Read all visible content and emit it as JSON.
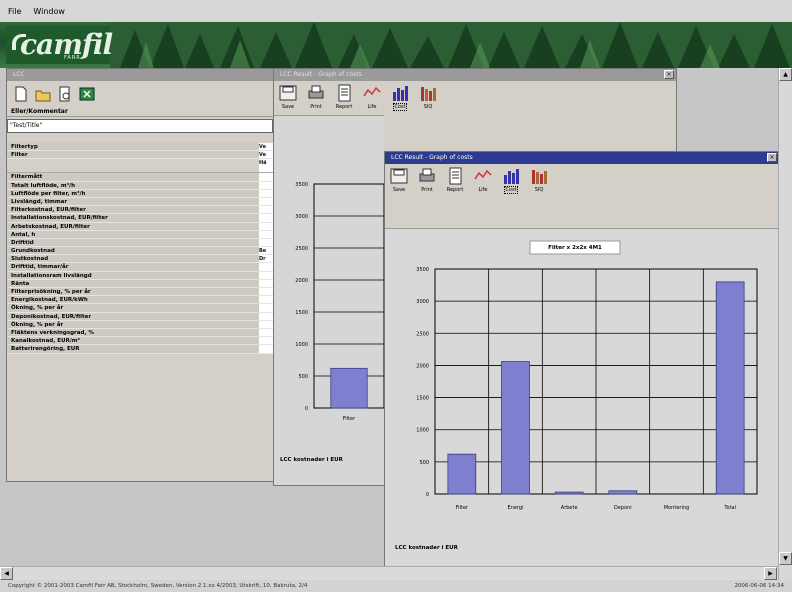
{
  "menubar": {
    "items": [
      "File",
      "Window"
    ]
  },
  "banner": {
    "logo": "camfil",
    "logo_sub": "FARR"
  },
  "input_panel": {
    "title": "LCC",
    "caption": "Eller/Kommentar",
    "text_value": "\"Test/Title\"",
    "params": [
      {
        "label": "Filtertyp",
        "value": "Ve"
      },
      {
        "label": "Filter",
        "value": "Ve"
      },
      {
        "label": "",
        "value": "Hä"
      },
      {
        "label": "Filtermått",
        "value": ""
      },
      {
        "label": "Totalt luftflöde, m³/h",
        "value": ""
      },
      {
        "label": "Luftflöde per filter, m³/h",
        "value": ""
      },
      {
        "label": "Livslängd, timmar",
        "value": ""
      },
      {
        "label": "Filterkostnad, EUR/filter",
        "value": ""
      },
      {
        "label": "Installationskostnad, EUR/filter",
        "value": ""
      },
      {
        "label": "Arbetskostnad, EUR/filter",
        "value": ""
      },
      {
        "label": "Antal, h",
        "value": ""
      },
      {
        "label": "Drifttid",
        "value": ""
      },
      {
        "label": "Grundkostnad",
        "value": "Be"
      },
      {
        "label": "Slutkostnad",
        "value": "Dr"
      },
      {
        "label": "Drifttid, timmar/år",
        "value": ""
      },
      {
        "label": "Installationsram livslängd",
        "value": ""
      },
      {
        "label": "Ränta",
        "value": ""
      },
      {
        "label": "Filterprisökning, % per år",
        "value": ""
      },
      {
        "label": "Energikostnad, EUR/kWh",
        "value": ""
      },
      {
        "label": "Ökning, % per år",
        "value": ""
      },
      {
        "label": "Deponikostnad, EUR/filter",
        "value": ""
      },
      {
        "label": "Ökning, % per år",
        "value": ""
      },
      {
        "label": "Fläktens verkningsgrad, %",
        "value": ""
      },
      {
        "label": "Kanalkostnad, EUR/m²",
        "value": ""
      },
      {
        "label": "Batterirengöring, EUR",
        "value": ""
      }
    ]
  },
  "back_window": {
    "title": "LCC Result - Graph of costs",
    "tools": [
      "Save",
      "Print",
      "Report",
      "Life",
      "Cost",
      "SIQ"
    ],
    "active_tool": "Cost",
    "footer": "LCC kostnader i EUR",
    "chart_data": {
      "type": "bar",
      "categories": [
        "Filter"
      ],
      "values": [
        620
      ],
      "yticks": [
        0,
        500,
        1000,
        1500,
        2000,
        2500,
        3000,
        3500
      ],
      "ylim": [
        0,
        3500
      ],
      "xlabel": "",
      "ylabel": ""
    }
  },
  "front_window": {
    "title": "LCC Result - Graph of costs",
    "tools": [
      "Save",
      "Print",
      "Report",
      "Life",
      "Cost",
      "SIQ"
    ],
    "active_tool": "Cost",
    "chart_title": "Filter x 2x2x 4M1",
    "footer": "LCC kostnader i EUR",
    "colors": {
      "bar": "#7f7fcf",
      "bar_edge": "#3a3a80",
      "grid": "#000000"
    },
    "chart_data": {
      "type": "bar",
      "categories": [
        "Filter",
        "Energi",
        "Arbete",
        "Deponi",
        "Montering",
        "Total"
      ],
      "values": [
        620,
        2060,
        30,
        50,
        0,
        3300
      ],
      "yticks": [
        0,
        500,
        1000,
        1500,
        2000,
        2500,
        3000,
        3500
      ],
      "ylim": [
        0,
        3500
      ],
      "xlabel": "",
      "ylabel": ""
    }
  },
  "statusbar": {
    "left": "Copyright © 2001-2003 Camfil Farr AB, Stockholm, Sweden, Version 2.1.xx 4/2003, Utskrift, 10, Bakruta, 2/4",
    "right": "2006-06-06 14:34"
  }
}
